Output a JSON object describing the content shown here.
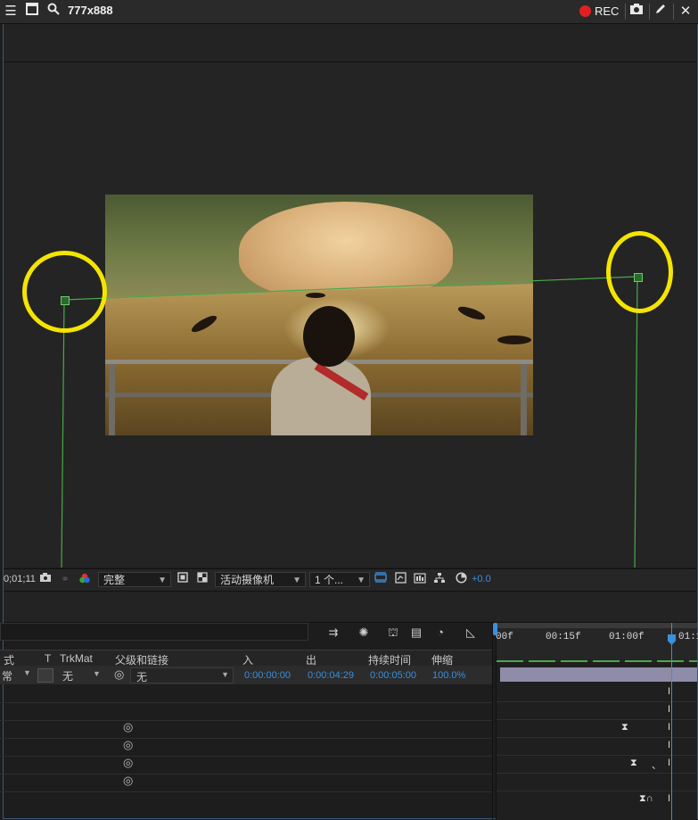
{
  "window": {
    "title": "777x888",
    "rec_label": "REC"
  },
  "icons": [
    "menu-icon",
    "window-icon",
    "zoom-icon",
    "record-icon",
    "camera-icon",
    "pen-icon",
    "close-icon",
    "snapshot-icon",
    "color-channel-icon",
    "region-of-interest-icon",
    "transparency-grid-icon",
    "draft-3d-icon",
    "flowchart-icon",
    "reset-exposure-icon",
    "parent-pickwhip-icon"
  ],
  "viewer_toolbar": {
    "timecode": "0;01;11",
    "resolution": "完整",
    "camera": "活动摄像机",
    "views": "1 个...",
    "exposure": "+0.0"
  },
  "timeline": {
    "columns": {
      "mode": "式",
      "t": "T",
      "trkmat": "TrkMat",
      "parent": "父级和链接",
      "in": "入",
      "out": "出",
      "duration": "持续时间",
      "stretch": "伸缩"
    },
    "row": {
      "mode": "常",
      "trkmat": "无",
      "parent": "无",
      "in": "0:00:00:00",
      "out": "0:00:04:29",
      "duration": "0:00:05:00",
      "stretch": "100.0%"
    },
    "ruler": [
      "00f",
      "00:15f",
      "01:00f",
      "01:1"
    ]
  },
  "colors": {
    "accent_blue": "#3b8fdc",
    "highlight_yellow": "#f4e400",
    "guide_green": "#4aa84a",
    "rec_red": "#e02020"
  }
}
